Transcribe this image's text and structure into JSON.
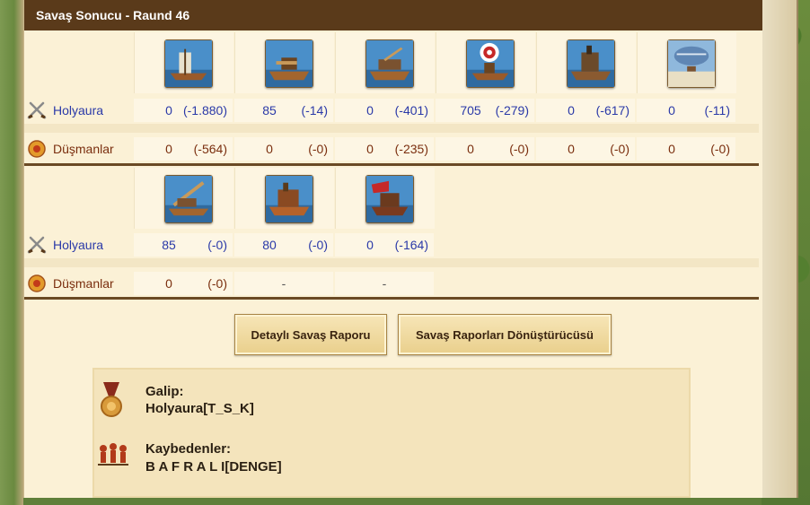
{
  "header": {
    "title": "Savaş Sonucu - Raund 46"
  },
  "players": {
    "attacker": "Holyaura",
    "defender": "Düşmanlar"
  },
  "table1": {
    "units": [
      {
        "icon": "fire-ship-icon"
      },
      {
        "icon": "ballista-ship-icon"
      },
      {
        "icon": "catapult-ship-icon"
      },
      {
        "icon": "mortar-ship-icon"
      },
      {
        "icon": "steam-ram-icon"
      },
      {
        "icon": "balloon-carrier-icon"
      }
    ],
    "attacker": [
      {
        "count": "0",
        "loss": "(-1.880)"
      },
      {
        "count": "85",
        "loss": "(-14)"
      },
      {
        "count": "0",
        "loss": "(-401)"
      },
      {
        "count": "705",
        "loss": "(-279)"
      },
      {
        "count": "0",
        "loss": "(-617)"
      },
      {
        "count": "0",
        "loss": "(-11)"
      }
    ],
    "defender": [
      {
        "count": "0",
        "loss": "(-564)"
      },
      {
        "count": "0",
        "loss": "(-0)"
      },
      {
        "count": "0",
        "loss": "(-235)"
      },
      {
        "count": "0",
        "loss": "(-0)"
      },
      {
        "count": "0",
        "loss": "(-0)"
      },
      {
        "count": "0",
        "loss": "(-0)"
      }
    ]
  },
  "table2": {
    "units": [
      {
        "icon": "ram-ship-icon"
      },
      {
        "icon": "rocket-ship-icon"
      },
      {
        "icon": "tender-ship-icon"
      }
    ],
    "attacker": [
      {
        "count": "85",
        "loss": "(-0)"
      },
      {
        "count": "80",
        "loss": "(-0)"
      },
      {
        "count": "0",
        "loss": "(-164)"
      }
    ],
    "defender": [
      {
        "count": "0",
        "loss": "(-0)"
      },
      {
        "dash": "-"
      },
      {
        "dash": "-"
      }
    ]
  },
  "buttons": {
    "detailed_report": "Detaylı Savaş Raporu",
    "report_converter": "Savaş Raporları Dönüştürücüsü"
  },
  "result": {
    "winner_label": "Galip:",
    "winner_value": "Holyaura[T_S_K]",
    "losers_label": "Kaybedenler:",
    "losers_value": "B A F R A L I[DENGE]"
  },
  "colors": {
    "header_bg": "#5a3a1a",
    "attacker_text": "#2a39a8",
    "defender_text": "#7a2e0e",
    "panel_bg": "#fbf1d6"
  }
}
